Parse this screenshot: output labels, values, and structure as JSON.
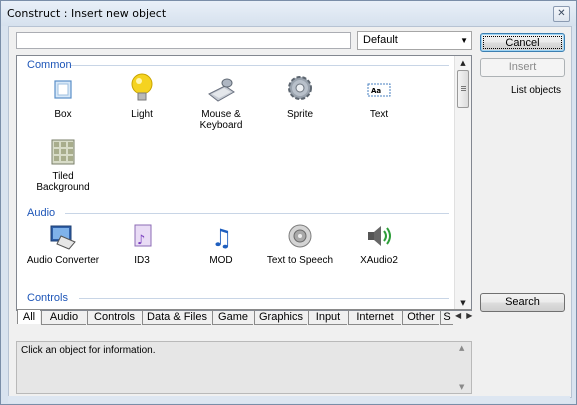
{
  "window": {
    "title": "Construct : Insert new object",
    "close_glyph": "✕"
  },
  "search": {
    "value": "",
    "placeholder": ""
  },
  "filter": {
    "selected": "Default"
  },
  "sections": {
    "common": {
      "label": "Common",
      "items": [
        {
          "label": "Box",
          "icon": "box-icon"
        },
        {
          "label": "Light",
          "icon": "lightbulb-icon"
        },
        {
          "label": "Mouse & Keyboard",
          "icon": "mouse-keyboard-icon"
        },
        {
          "label": "Sprite",
          "icon": "gear-icon"
        },
        {
          "label": "Text",
          "icon": "text-icon"
        },
        {
          "label": "Tiled Background",
          "icon": "tiled-background-icon"
        }
      ]
    },
    "audio": {
      "label": "Audio",
      "items": [
        {
          "label": "Audio Converter",
          "icon": "audio-converter-icon"
        },
        {
          "label": "ID3",
          "icon": "id3-icon"
        },
        {
          "label": "MOD",
          "icon": "music-note-icon"
        },
        {
          "label": "Text to Speech",
          "icon": "speaker-icon"
        },
        {
          "label": "XAudio2",
          "icon": "xaudio-icon"
        }
      ]
    },
    "controls": {
      "label": "Controls"
    }
  },
  "tabs": [
    "All",
    "Audio",
    "Controls",
    "Data & Files",
    "Game",
    "Graphics",
    "Input",
    "Internet",
    "Other",
    "S"
  ],
  "info": {
    "text": "Click an object for information."
  },
  "buttons": {
    "cancel": "Cancel",
    "insert": "Insert",
    "list_objects": "List objects",
    "search": "Search"
  },
  "colors": {
    "section_heading": "#1e56b8",
    "title_bar": "#d6e1ee",
    "client_bg": "#f0f0f0"
  }
}
